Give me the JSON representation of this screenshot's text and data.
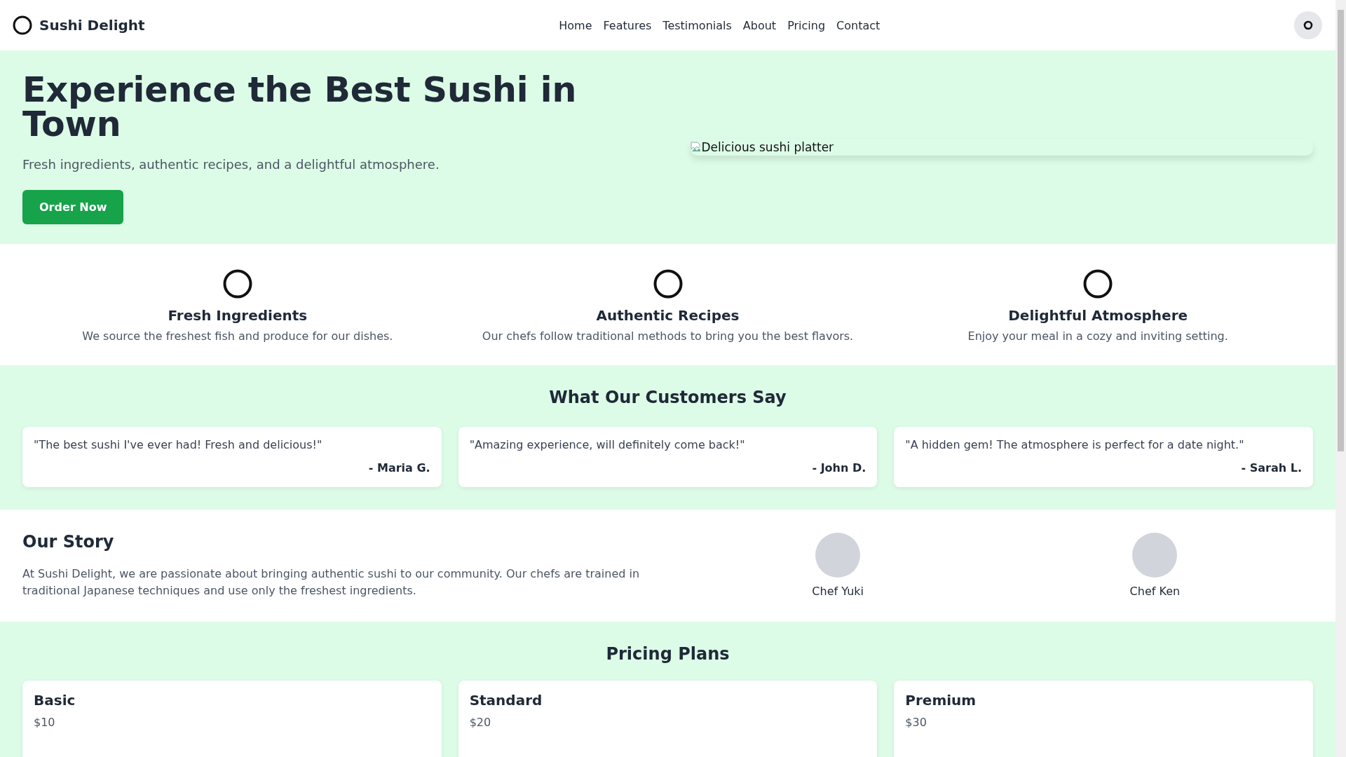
{
  "header": {
    "brand": "Sushi Delight",
    "nav": [
      "Home",
      "Features",
      "Testimonials",
      "About",
      "Pricing",
      "Contact"
    ]
  },
  "hero": {
    "title": "Experience the Best Sushi in Town",
    "subtitle": "Fresh ingredients, authentic recipes, and a delightful atmosphere.",
    "button": "Order Now",
    "image_alt": "Delicious sushi platter"
  },
  "features": [
    {
      "title": "Fresh Ingredients",
      "text": "We source the freshest fish and produce for our dishes."
    },
    {
      "title": "Authentic Recipes",
      "text": "Our chefs follow traditional methods to bring you the best flavors."
    },
    {
      "title": "Delightful Atmosphere",
      "text": "Enjoy your meal in a cozy and inviting setting."
    }
  ],
  "testimonials": {
    "heading": "What Our Customers Say",
    "items": [
      {
        "quote": "\"The best sushi I've ever had! Fresh and delicious!\"",
        "author": "- Maria G."
      },
      {
        "quote": "\"Amazing experience, will definitely come back!\"",
        "author": "- John D."
      },
      {
        "quote": "\"A hidden gem! The atmosphere is perfect for a date night.\"",
        "author": "- Sarah L."
      }
    ]
  },
  "story": {
    "heading": "Our Story",
    "text": "At Sushi Delight, we are passionate about bringing authentic sushi to our community. Our chefs are trained in traditional Japanese techniques and use only the freshest ingredients.",
    "chefs": [
      "Chef Yuki",
      "Chef Ken"
    ]
  },
  "pricing": {
    "heading": "Pricing Plans",
    "plans": [
      {
        "name": "Basic",
        "price": "$10"
      },
      {
        "name": "Standard",
        "price": "$20"
      },
      {
        "name": "Premium",
        "price": "$30"
      }
    ]
  }
}
